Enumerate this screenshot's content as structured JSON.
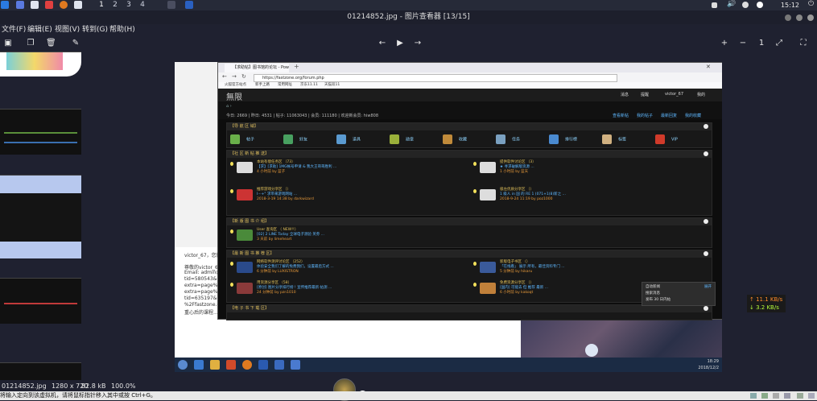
{
  "top_panel": {
    "workspaces": [
      "1",
      "2",
      "3",
      "4"
    ],
    "active_workspace": "1",
    "clock": "15:12"
  },
  "viewer": {
    "title": "01214852.jpg - 图片查看器 [13/15]",
    "menu": [
      "文件(F)",
      "编辑(E)",
      "视图(V)",
      "转到(G)",
      "帮助(H)"
    ]
  },
  "statusbar": {
    "filename": "01214852.jpg",
    "dimensions": "1280 x 720",
    "size": "82.8 kB",
    "zoom": "100.0%"
  },
  "bottom_hint": "将输入定向到该虚拟机，请将鼠标指针移入其中或按 Ctrl+G。",
  "speed": {
    "up": "↑ 11.1 KB/s",
    "down": "↓ 3.2 KB/s"
  },
  "screenshot": {
    "browser_tab": "【求助帖】图书馆的论坛 - Powe",
    "url": "https://fastzone.org/forum.php",
    "bookmarks": [
      "火狐官方站点",
      "新手上路",
      "常用网址",
      "京东11.11",
      "天猫双11"
    ],
    "forum": {
      "logo": "無限",
      "user": "victor_67",
      "header_links": [
        "消息",
        "提醒",
        "我的"
      ],
      "stats": "今日: 2669 | 昨日: 4531 | 帖子: 11063043 | 会员: 111180 | 欢迎新会员: hiw808",
      "sub_links": [
        "查看新帖",
        "我的帖子",
        "最新回复",
        "我的收藏"
      ],
      "nav_section_title": "【导 航 区 域】",
      "nav_items": [
        "帖子",
        "好友",
        "道具",
        "勋章",
        "收藏",
        "任务",
        "排行榜",
        "标签",
        "VIP"
      ],
      "sections": [
        {
          "title": "【社 区 新 帖 推 送】",
          "items": [
            {
              "title": "本站有偿任务区 （73）",
              "desc": "【求】[求助] 1MG帐号申请 & 我大王哥哥胜利 ...",
              "meta": "4 小时前 by 蓝子"
            },
            {
              "title": "提供软件讨论区 （3）",
              "desc": "★ 寻求破解版资源 ...",
              "meta": "1 小时前 by 蓝天"
            },
            {
              "title": "推荐游戏分享区 （）",
              "desc": "I···+\" 求带来游戏网站 ...",
              "meta": "2018-3-19 14:38 by darkwizard"
            },
            {
              "title": "极左优质分享区 （）",
              "desc": "1 级人 in 国 的 RE 1 (071+1(8)新之 ...",
              "meta": "2018-9-24 11:19 by poz1000"
            }
          ]
        },
        {
          "title": "【新 版 图 书 介 绍】",
          "items": [
            {
              "title": "User 查询区 （ NEW!!）",
              "desc": "[02] 2 LINE Today 全球电子测验 英券 ...",
              "meta": "3 天前 by limeheart"
            }
          ]
        },
        {
          "title": "【最 新 图 书 推 荐 区】",
          "items": [
            {
              "title": "网络软件测评讨论区 （252）",
              "desc": "体验安全我们了解的免费我们，设置最后方式 ...",
              "meta": "6 分钟前 by LUXISTRON"
            },
            {
              "title": "新版电子书区 （）",
              "desc": "「在线看」 展示 所有，最佳资料专门 ...",
              "meta": "5 分钟前 by hikaru"
            },
            {
              "title": "用资源分享区 （58）",
              "desc": "[原创] 图片分享排行榜 ! 宣传推荐最新 帖测 ...",
              "meta": "24 分钟前 by pzn1010"
            },
            {
              "title": "免费资源分享区 （）",
              "desc": "[国内] 可能去 但 推荐 最新 ...",
              "meta": "6 小时前 by kakoqt"
            }
          ]
        },
        {
          "title": "【电 子 书 下 载 区】",
          "items": []
        }
      ],
      "chat_popup": {
        "line1": "自动新闻",
        "line2": "搜索消息",
        "line3": "发布 30 日内帖",
        "action": "展开"
      }
    },
    "left_doc": [
      "victor_67，您好！",
      "尊敬的victor_67...",
      "Email: admin@fa...",
      "tid=580543&extra",
      "extra=page%3D1",
      "extra=page%3D1",
      "tid=635197&extr",
      "%2Ffastzone.org%",
      "重心后的课程..."
    ],
    "taskbar_time": "18:29",
    "taskbar_date": "2018/12/2"
  },
  "colors": {
    "desktop_bg": "#1f2130",
    "forum_bg": "#0d0d0d",
    "forum_title": "#e0c05a",
    "forum_link": "#5fb8ff",
    "forum_meta": "#e89a3a",
    "speed_up": "#ff8a2a",
    "speed_down": "#b6ff3a"
  }
}
